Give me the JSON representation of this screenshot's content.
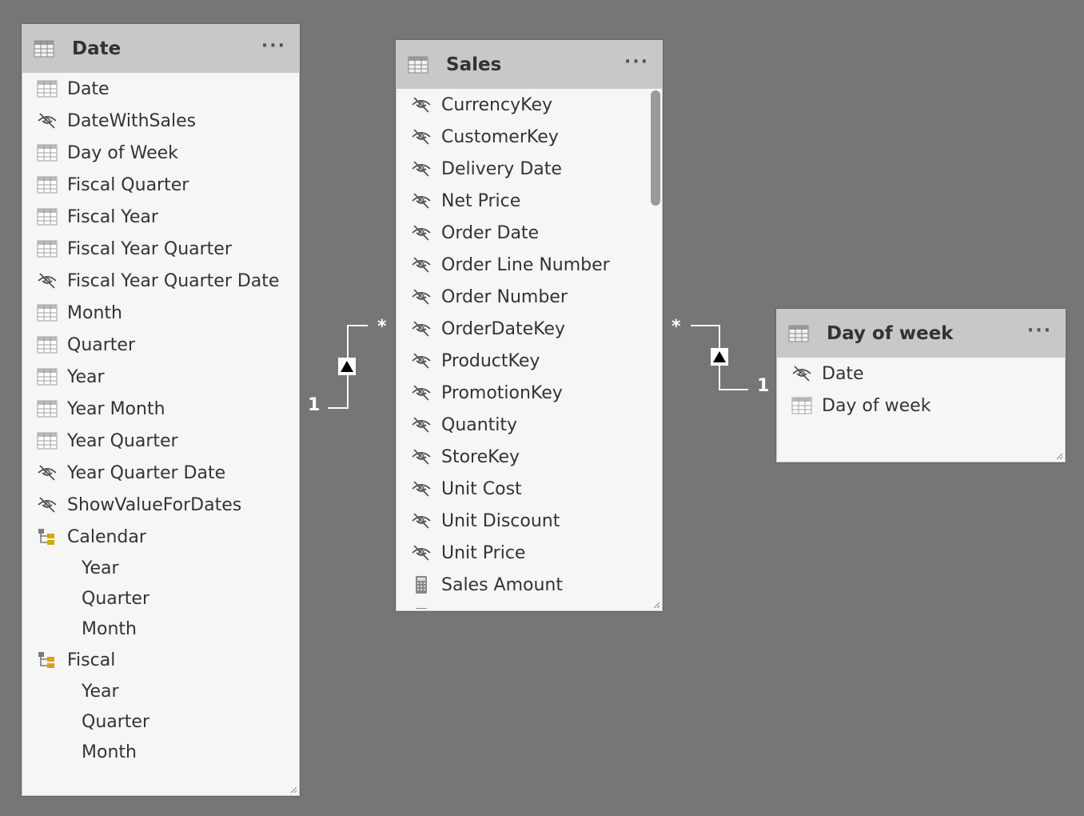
{
  "tables": {
    "date": {
      "title": "Date",
      "more": "···",
      "fields": [
        {
          "label": "Date",
          "icon": "table-column-icon"
        },
        {
          "label": "DateWithSales",
          "icon": "hidden-eye-icon"
        },
        {
          "label": "Day of Week",
          "icon": "table-column-icon"
        },
        {
          "label": "Fiscal Quarter",
          "icon": "table-column-icon"
        },
        {
          "label": "Fiscal Year",
          "icon": "table-column-icon"
        },
        {
          "label": "Fiscal Year Quarter",
          "icon": "table-column-icon"
        },
        {
          "label": "Fiscal Year Quarter Date",
          "icon": "hidden-eye-icon"
        },
        {
          "label": "Month",
          "icon": "table-column-icon"
        },
        {
          "label": "Quarter",
          "icon": "table-column-icon"
        },
        {
          "label": "Year",
          "icon": "table-column-icon"
        },
        {
          "label": "Year Month",
          "icon": "table-column-icon"
        },
        {
          "label": "Year Quarter",
          "icon": "table-column-icon"
        },
        {
          "label": "Year Quarter Date",
          "icon": "hidden-eye-icon"
        },
        {
          "label": "ShowValueForDates",
          "icon": "hidden-eye-icon"
        }
      ],
      "hierarchies": [
        {
          "label": "Calendar",
          "icon": "hierarchy-icon",
          "levels": [
            "Year",
            "Quarter",
            "Month"
          ]
        },
        {
          "label": "Fiscal",
          "icon": "hierarchy-icon",
          "levels": [
            "Year",
            "Quarter",
            "Month"
          ]
        }
      ]
    },
    "sales": {
      "title": "Sales",
      "more": "···",
      "fields": [
        {
          "label": "CurrencyKey",
          "icon": "hidden-eye-icon"
        },
        {
          "label": "CustomerKey",
          "icon": "hidden-eye-icon"
        },
        {
          "label": "Delivery Date",
          "icon": "hidden-eye-icon"
        },
        {
          "label": "Net Price",
          "icon": "hidden-eye-icon"
        },
        {
          "label": "Order Date",
          "icon": "hidden-eye-icon"
        },
        {
          "label": "Order Line Number",
          "icon": "hidden-eye-icon"
        },
        {
          "label": "Order Number",
          "icon": "hidden-eye-icon"
        },
        {
          "label": "OrderDateKey",
          "icon": "hidden-eye-icon"
        },
        {
          "label": "ProductKey",
          "icon": "hidden-eye-icon"
        },
        {
          "label": "PromotionKey",
          "icon": "hidden-eye-icon"
        },
        {
          "label": "Quantity",
          "icon": "hidden-eye-icon"
        },
        {
          "label": "StoreKey",
          "icon": "hidden-eye-icon"
        },
        {
          "label": "Unit Cost",
          "icon": "hidden-eye-icon"
        },
        {
          "label": "Unit Discount",
          "icon": "hidden-eye-icon"
        },
        {
          "label": "Unit Price",
          "icon": "hidden-eye-icon"
        },
        {
          "label": "Sales Amount",
          "icon": "calculator-icon"
        },
        {
          "label": "Sales (USD)",
          "icon": "calculator-icon"
        }
      ]
    },
    "dayofweek": {
      "title": "Day of week",
      "more": "···",
      "fields": [
        {
          "label": "Date",
          "icon": "hidden-eye-icon"
        },
        {
          "label": "Day of week",
          "icon": "table-column-icon"
        }
      ]
    }
  },
  "relationships": {
    "date_sales": {
      "one_label": "1",
      "many_label": "*"
    },
    "sales_dayofweek": {
      "one_label": "1",
      "many_label": "*"
    }
  }
}
